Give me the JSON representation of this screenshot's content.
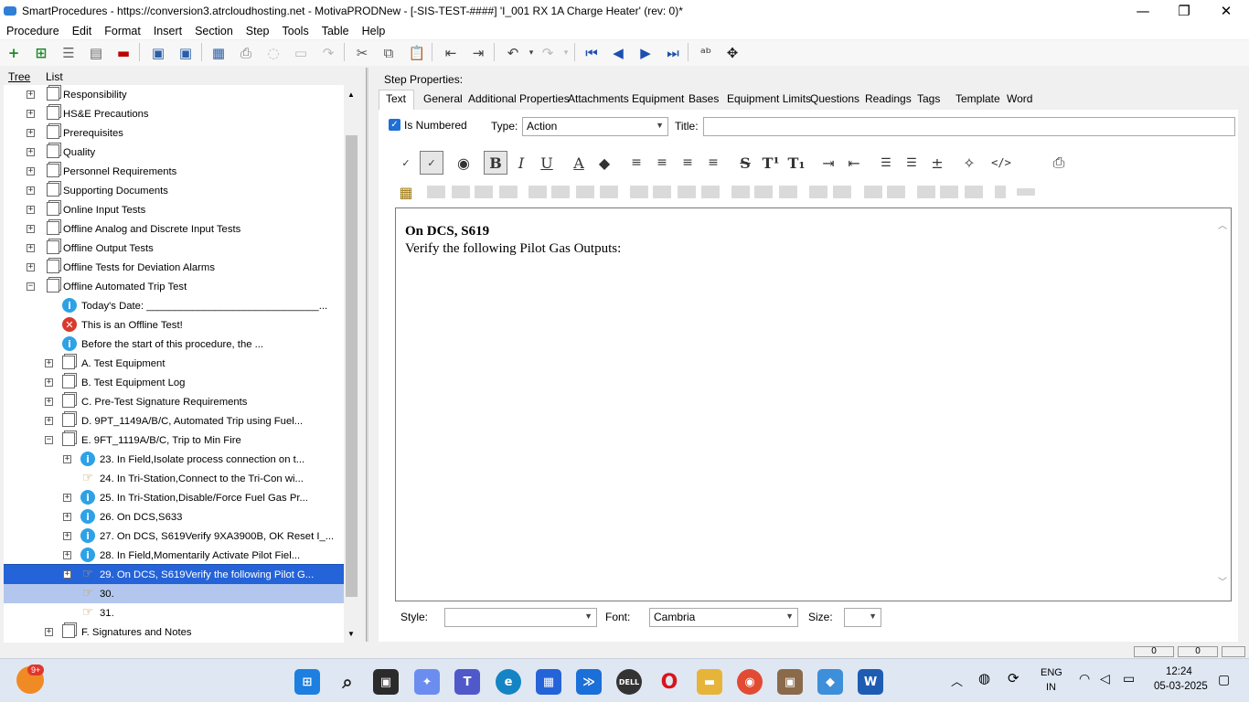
{
  "window": {
    "title": "SmartProcedures - https://conversion3.atrcloudhosting.net - MotivaPRODNew - [-SIS-TEST-####] 'I_001 RX 1A Charge Heater' (rev: 0)*",
    "minimize": "—",
    "restore": "❐",
    "close": "✕"
  },
  "menu": [
    "Procedure",
    "Edit",
    "Format",
    "Insert",
    "Section",
    "Step",
    "Tools",
    "Table",
    "Help"
  ],
  "left_tabs": {
    "tree": "Tree",
    "list": "List"
  },
  "tree": [
    {
      "label": "Responsibility",
      "icon": "section-icon",
      "exp": "+",
      "indent": 0
    },
    {
      "label": "HS&E Precautions",
      "icon": "section-icon",
      "exp": "+",
      "indent": 0
    },
    {
      "label": "Prerequisites",
      "icon": "section-icon",
      "exp": "+",
      "indent": 0
    },
    {
      "label": "Quality",
      "icon": "section-icon",
      "exp": "+",
      "indent": 0
    },
    {
      "label": "Personnel Requirements",
      "icon": "section-icon",
      "exp": "+",
      "indent": 0
    },
    {
      "label": "Supporting Documents",
      "icon": "section-icon",
      "exp": "+",
      "indent": 0
    },
    {
      "label": "Online Input Tests",
      "icon": "section-icon",
      "exp": "+",
      "indent": 0
    },
    {
      "label": "Offline Analog and Discrete Input Tests",
      "icon": "section-icon",
      "exp": "+",
      "indent": 0
    },
    {
      "label": "Offline Output Tests",
      "icon": "section-icon",
      "exp": "+",
      "indent": 0
    },
    {
      "label": "Offline Tests for Deviation Alarms",
      "icon": "section-icon",
      "exp": "+",
      "indent": 0
    },
    {
      "label": "Offline Automated Trip Test",
      "icon": "section-icon",
      "exp": "−",
      "indent": 0
    },
    {
      "label": "Today's Date: ______________________________...",
      "icon": "info-icon",
      "exp": "",
      "indent": 1
    },
    {
      "label": "This is an Offline Test!",
      "icon": "warning-x-icon",
      "exp": "",
      "indent": 1
    },
    {
      "label": "Before the start of this procedure, the ...",
      "icon": "info-icon",
      "exp": "",
      "indent": 1
    },
    {
      "label": "A. Test Equipment",
      "icon": "section-icon",
      "exp": "+",
      "indent": 1
    },
    {
      "label": "B. Test Equipment Log",
      "icon": "section-icon",
      "exp": "+",
      "indent": 1
    },
    {
      "label": "C. Pre-Test Signature Requirements",
      "icon": "section-icon",
      "exp": "+",
      "indent": 1
    },
    {
      "label": "D. 9PT_1149A/B/C, Automated Trip using Fuel...",
      "icon": "section-icon",
      "exp": "+",
      "indent": 1
    },
    {
      "label": "E. 9FT_1119A/B/C, Trip to Min Fire",
      "icon": "section-icon",
      "exp": "−",
      "indent": 1
    },
    {
      "label": "23. In Field,Isolate process connection on t...",
      "icon": "info-icon",
      "exp": "+",
      "indent": 2
    },
    {
      "label": "24. In Tri-Station,Connect to the Tri-Con wi...",
      "icon": "action-hand-icon",
      "exp": "",
      "indent": 2
    },
    {
      "label": "25. In Tri-Station,Disable/Force Fuel Gas Pr...",
      "icon": "info-icon",
      "exp": "+",
      "indent": 2
    },
    {
      "label": "26. On DCS,S633",
      "icon": "info-icon",
      "exp": "+",
      "indent": 2
    },
    {
      "label": "27. On DCS, S619Verify 9XA3900B, OK Reset I_...",
      "icon": "info-icon",
      "exp": "+",
      "indent": 2
    },
    {
      "label": "28. In Field,Momentarily Activate Pilot Fiel...",
      "icon": "info-icon",
      "exp": "+",
      "indent": 2
    },
    {
      "label": "29. On DCS, S619Verify the following Pilot G...",
      "icon": "action-hand-icon",
      "exp": "+",
      "indent": 2,
      "state": "selected"
    },
    {
      "label": "30.",
      "icon": "action-hand-icon",
      "exp": "",
      "indent": 2,
      "state": "highlight"
    },
    {
      "label": "31.",
      "icon": "action-hand-icon",
      "exp": "",
      "indent": 2
    },
    {
      "label": "F. Signatures and Notes",
      "icon": "section-icon",
      "exp": "+",
      "indent": 1
    }
  ],
  "step_properties": {
    "title": "Step Properties:",
    "tabs": [
      "Text",
      "General",
      "Additional Properties",
      "Attachments",
      "Equipment",
      "Bases",
      "Equipment Limits",
      "Questions",
      "Readings",
      "Tags",
      "Template",
      "Word"
    ],
    "is_numbered_label": "Is Numbered",
    "is_numbered_checked": true,
    "type_label": "Type:",
    "type_value": "Action",
    "title_label": "Title:",
    "title_value": ""
  },
  "editor": {
    "line1": "On DCS, S619",
    "line2": "Verify the following Pilot Gas Outputs:"
  },
  "format_bar": {
    "style_label": "Style:",
    "style_value": "",
    "font_label": "Font:",
    "font_value": "Cambria",
    "size_label": "Size:",
    "size_value": ""
  },
  "status": {
    "cell1": "0",
    "cell2": "0"
  },
  "tray": {
    "lang_top": "ENG",
    "lang_bottom": "IN",
    "time": "12:24",
    "date": "05-03-2025",
    "badge": "9+"
  }
}
